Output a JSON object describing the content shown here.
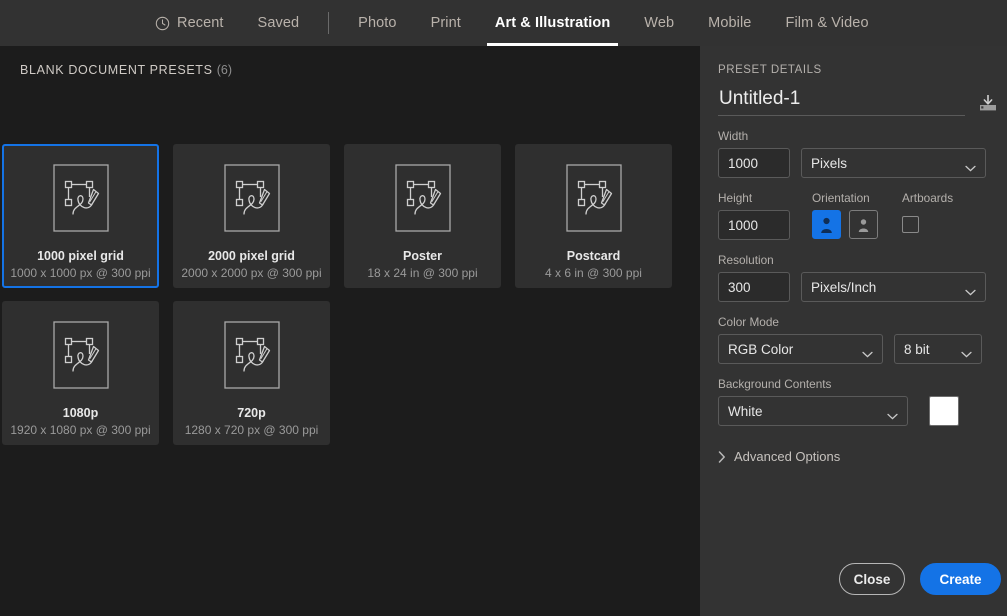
{
  "tabs": [
    {
      "label": "Recent",
      "icon": "clock-icon",
      "active": false
    },
    {
      "label": "Saved",
      "icon": null,
      "active": false
    },
    {
      "label": "Photo",
      "icon": null,
      "active": false
    },
    {
      "label": "Print",
      "icon": null,
      "active": false
    },
    {
      "label": "Art & Illustration",
      "icon": null,
      "active": true
    },
    {
      "label": "Web",
      "icon": null,
      "active": false
    },
    {
      "label": "Mobile",
      "icon": null,
      "active": false
    },
    {
      "label": "Film & Video",
      "icon": null,
      "active": false
    }
  ],
  "presets": {
    "heading": "BLANK DOCUMENT PRESETS",
    "count": "(6)",
    "items": [
      {
        "name": "1000 pixel grid",
        "spec": "1000 x 1000 px @ 300 ppi",
        "selected": true
      },
      {
        "name": "2000 pixel grid",
        "spec": "2000 x 2000 px @ 300 ppi",
        "selected": false
      },
      {
        "name": "Poster",
        "spec": "18 x 24 in @ 300 ppi",
        "selected": false
      },
      {
        "name": "Postcard",
        "spec": "4 x 6 in @ 300 ppi",
        "selected": false
      },
      {
        "name": "1080p",
        "spec": "1920 x 1080 px @ 300 ppi",
        "selected": false
      },
      {
        "name": "720p",
        "spec": "1280 x 720 px @ 300 ppi",
        "selected": false
      }
    ]
  },
  "details": {
    "section_label": "PRESET DETAILS",
    "document_name": "Untitled-1",
    "document_name_placeholder": "Untitled-1",
    "save_preset_icon": "save-preset-icon",
    "width": {
      "label": "Width",
      "value": "1000"
    },
    "units": {
      "value": "Pixels"
    },
    "height": {
      "label": "Height",
      "value": "1000"
    },
    "orientation": {
      "label": "Orientation",
      "portrait_selected": true,
      "landscape_selected": false
    },
    "artboards": {
      "label": "Artboards",
      "checked": false
    },
    "resolution": {
      "label": "Resolution",
      "value": "300"
    },
    "resolution_units": {
      "value": "Pixels/Inch"
    },
    "color_mode": {
      "label": "Color Mode",
      "value": "RGB Color"
    },
    "bit_depth": {
      "value": "8 bit"
    },
    "background": {
      "label": "Background Contents",
      "value": "White",
      "swatch_color": "#ffffff"
    },
    "advanced": {
      "label": "Advanced Options",
      "expanded": false
    }
  },
  "footer": {
    "close_label": "Close",
    "create_label": "Create"
  },
  "colors": {
    "accent": "#1473e6",
    "tabbar_bg": "#323232",
    "left_bg": "#1c1c1c",
    "right_bg": "#333333",
    "card_bg": "#2f2f2f"
  }
}
